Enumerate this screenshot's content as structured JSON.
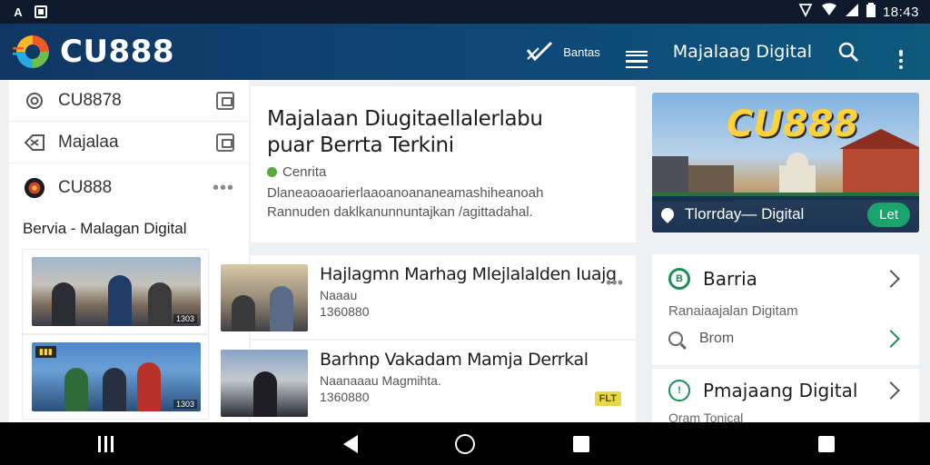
{
  "status_bar": {
    "time": "18:43"
  },
  "app_bar": {
    "brand": "CU888",
    "action_label": "Bantas",
    "title": "Majalaag Digital"
  },
  "sidebar": {
    "items": [
      {
        "label": "CU8878"
      },
      {
        "label": "Majalaa"
      },
      {
        "label": "CU888"
      }
    ],
    "section_title": "Bervia - Malagan Digital",
    "thumbs": [
      {
        "label": "1303"
      },
      {
        "label": "1303"
      }
    ]
  },
  "hero": {
    "title_line1": "Majalaan Diugitaellalerlabu",
    "title_line2": "puar Berrta Terkini",
    "category": "Cenrita",
    "desc_line1": "Dlaneaoaoarierlaaoanoananeamashiheanoah",
    "desc_line2": "Rannuden daklkanunnuntajkan /agittadahal."
  },
  "articles": [
    {
      "title": "Hajlagmn Marhag Mlejlalalden Iuajg",
      "meta": "Naaau",
      "date": "1360880"
    },
    {
      "title": "Barhnp Vakadam Mamja Derrkal",
      "meta": "Naanaaau Magmihta.",
      "date": "1360880",
      "badge": "FLT"
    }
  ],
  "banner": {
    "logo": "CU888",
    "caption": "Tlorrday— Digital",
    "button": "Let"
  },
  "menu": {
    "card1_title": "Barria",
    "card1_sub": "Ranaiaajalan Digitam",
    "search_text": "Brom",
    "card2_title": "Pmajaang Digital",
    "card2_sub": "Oram Tonical"
  },
  "colors": {
    "app_bar_start": "#103763",
    "app_bar_end": "#0d5a7c",
    "accent_green": "#1a8f55"
  }
}
